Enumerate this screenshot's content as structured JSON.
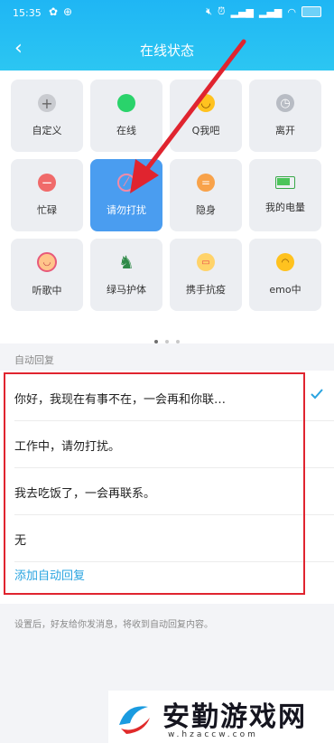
{
  "statusbar": {
    "time": "15:35"
  },
  "header": {
    "back": "‹",
    "title": "在线状态"
  },
  "tiles": [
    {
      "label": "自定义"
    },
    {
      "label": "在线"
    },
    {
      "label": "Q我吧"
    },
    {
      "label": "离开"
    },
    {
      "label": "忙碌"
    },
    {
      "label": "请勿打扰"
    },
    {
      "label": "隐身"
    },
    {
      "label": "我的电量"
    },
    {
      "label": "听歌中"
    },
    {
      "label": "绿马护体"
    },
    {
      "label": "携手抗疫"
    },
    {
      "label": "emo中"
    }
  ],
  "auto_reply": {
    "section_label": "自动回复",
    "items": [
      {
        "text": "你好，我现在有事不在，一会再和你联…",
        "checked": true
      },
      {
        "text": "工作中，请勿打扰。",
        "checked": false
      },
      {
        "text": "我去吃饭了，一会再联系。",
        "checked": false
      },
      {
        "text": "无",
        "checked": false
      }
    ],
    "add_label": "添加自动回复",
    "note": "设置后，好友给你发消息，将收到自动回复内容。"
  },
  "watermark": {
    "text": "安勤游戏网",
    "url": "w.hzaccw.com"
  },
  "colors": {
    "header": "#1fb6f4",
    "selected_tile": "#4a9df0",
    "highlight_frame": "#e0242f",
    "link": "#2aa4e0"
  }
}
